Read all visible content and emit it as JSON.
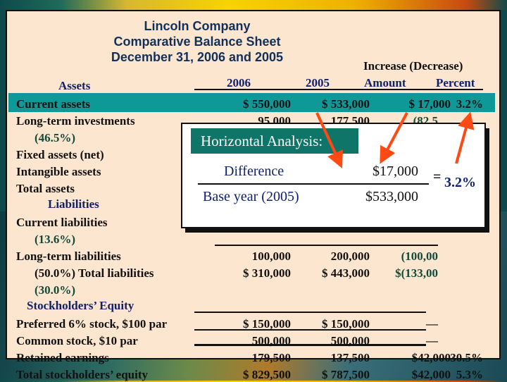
{
  "header": {
    "company": "Lincoln Company",
    "statement": "Comparative Balance Sheet",
    "date": "December 31, 2006 and 2005"
  },
  "columns": {
    "group": "Increase (Decrease)",
    "y2006": "2006",
    "y2005": "2005",
    "amount": "Amount",
    "percent": "Percent"
  },
  "rows": [
    {
      "label": "Assets",
      "type": "section",
      "indent": 60
    },
    {
      "label": "Current assets",
      "v2006": "$  550,000",
      "v2005": "$  533,000",
      "amount": "$   17,000",
      "percent": "3.2%",
      "highlight": true
    },
    {
      "label": "Long-term investments",
      "v2006": "95,000",
      "v2005": "177,500",
      "amount": "(82,5"
    },
    {
      "label": "(46.5%)",
      "type": "pct",
      "indent": 26
    },
    {
      "label": "Fixed assets (net)"
    },
    {
      "label": "Intangible assets"
    },
    {
      "label": "Total assets"
    },
    {
      "label": "Liabilities",
      "type": "section",
      "indent": 45
    },
    {
      "label": "Current liabilities"
    },
    {
      "label": "(13.6%)",
      "type": "pct",
      "indent": 26
    },
    {
      "label": "Long-term liabilities",
      "v2006": "100,000",
      "v2005": "200,000",
      "amount": "(100,00"
    },
    {
      "label": "(50.0%) Total liabilities",
      "type": "pctlabel",
      "indent": 26,
      "v2006": "$  310,000",
      "v2005": "$ 443,000",
      "amount": "$(133,00"
    },
    {
      "label": "(30.0%)",
      "type": "pct",
      "indent": 26
    },
    {
      "label": "Stockholders’ Equity",
      "type": "section",
      "indent": 15
    },
    {
      "label": "Preferred 6%  stock, $100 par",
      "v2006": "$  150,000",
      "v2005": "$ 150,000",
      "amount": "—"
    },
    {
      "label": "Common stock, $10 par",
      "v2006": "500,000",
      "v2005": "500,000",
      "amount": "—"
    },
    {
      "label": "Retained earnings",
      "v2006": "179,500",
      "v2005": "137,500",
      "amount": "$42,000",
      "percent": "30.5%"
    },
    {
      "label": "Total stockholders’ equity",
      "v2006": "$  829,500",
      "v2005": "$ 787,500",
      "amount": "$42,000",
      "percent": "5.3%"
    }
  ],
  "popup": {
    "title": "Horizontal Analysis:",
    "numerator_label": "Difference",
    "denominator_label": "Base year (2005)",
    "numerator": "$17,000",
    "denominator": "$533,000",
    "equals": "=",
    "result": "3.2%"
  },
  "colors": {
    "sheet": "#fde6cf",
    "highlight": "#0f9898",
    "popup_title": "#0e7568",
    "arrow": "#ff4a14",
    "section_text": "#10206a",
    "pct_text": "#0f4a3a"
  }
}
